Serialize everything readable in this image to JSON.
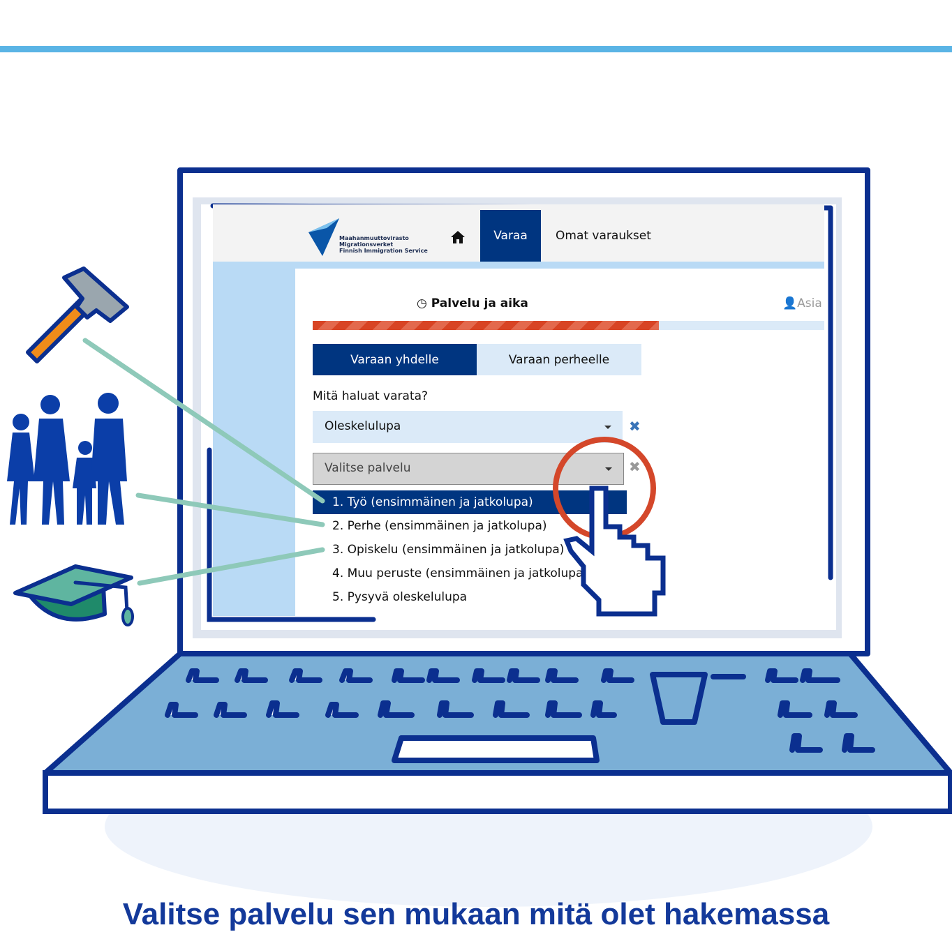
{
  "header": {
    "logo_lines": [
      "Maahanmuuttovirasto",
      "Migrationsverket",
      "Finnish Immigration Service"
    ],
    "icons": [
      "home-icon"
    ],
    "nav": {
      "varaa": "Varaa",
      "omat": "Omat varaukset"
    }
  },
  "step": {
    "icon": "clock-icon",
    "title": "Palvelu ja aika"
  },
  "user": {
    "icon": "user-icon",
    "label": "Asia"
  },
  "progress": {
    "fraction": 0.676
  },
  "tabs": {
    "yhdelle": "Varaan yhdelle",
    "perheelle": "Varaan perheelle"
  },
  "form": {
    "question": "Mitä haluat varata?",
    "select1_value": "Oleskelulupa",
    "select2_placeholder": "Valitse palvelu"
  },
  "dropdown": {
    "options": [
      "1. Työ (ensimmäinen ja jatkolupa)",
      "2. Perhe (ensimmäinen ja jatkolupa)",
      "3. Opiskelu (ensimmäinen ja jatkolupa)",
      "4. Muu peruste (ensimmäinen ja jatkolupa)",
      "5. Pysyvä oleskelulupa"
    ],
    "highlighted_index": 0
  },
  "illustration_icons": [
    "hammer-icon",
    "family-icon",
    "graduation-cap-icon",
    "hand-cursor-icon"
  ],
  "caption": "Valitse palvelu sen mukaan mitä olet hakemassa",
  "colors": {
    "brand_blue": "#003580",
    "light_blue": "#b9daf5",
    "progress_red": "#d84424",
    "accent_circle": "#d4472a",
    "line_blue": "#0b2f8f",
    "connector": "#8ec9b9"
  }
}
